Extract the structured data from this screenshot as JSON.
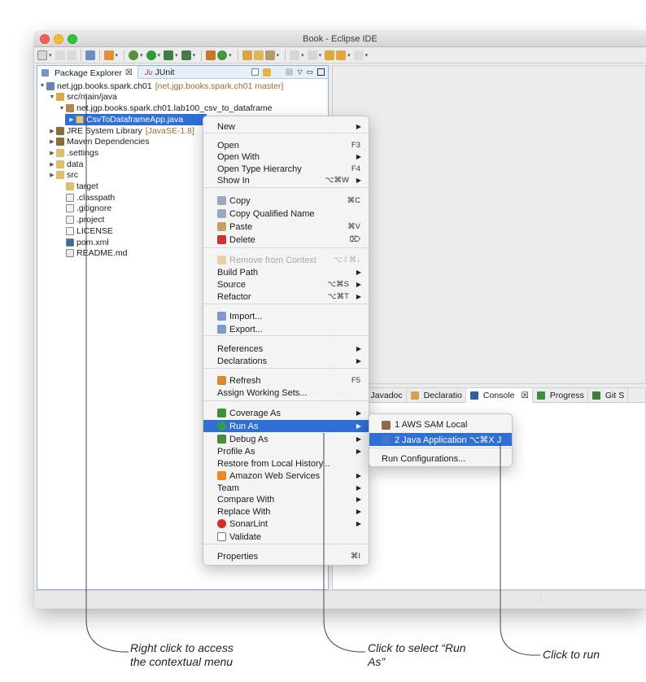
{
  "window": {
    "title": "Book - Eclipse IDE"
  },
  "explorer": {
    "tab_label": "Package Explorer",
    "tab_close": "☒",
    "junit_tab": "JUnit",
    "junit_prefix": "Ju",
    "tree": [
      {
        "label": "net.jgp.books.spark.ch01",
        "deco": "[net.jgp.books.spark.ch01 master]",
        "icon": "project-icon",
        "twisty": "▼"
      },
      {
        "label": "src/main/java",
        "deco": "",
        "icon": "source-folder-icon",
        "twisty": "▼"
      },
      {
        "label": "net.jgp.books.spark.ch01.lab100_csv_to_dataframe",
        "deco": "",
        "icon": "package-icon",
        "twisty": "▼"
      },
      {
        "label": "CsvToDataframeApp.java",
        "deco": "",
        "icon": "java-file-icon",
        "twisty": "▶"
      },
      {
        "label": "JRE System Library",
        "deco": "[JavaSE-1.8]",
        "icon": "library-icon",
        "twisty": "▶"
      },
      {
        "label": "Maven Dependencies",
        "deco": "",
        "icon": "library-icon",
        "twisty": "▶"
      },
      {
        "label": ".settings",
        "deco": "",
        "icon": "folder-icon",
        "twisty": "▶"
      },
      {
        "label": "data",
        "deco": "",
        "icon": "folder-icon",
        "twisty": "▶"
      },
      {
        "label": "src",
        "deco": "",
        "icon": "folder-icon",
        "twisty": "▶"
      },
      {
        "label": "target",
        "deco": "",
        "icon": "folder-icon",
        "twisty": ""
      },
      {
        "label": ".classpath",
        "deco": "",
        "icon": "xml-file-icon",
        "twisty": ""
      },
      {
        "label": ".gitignore",
        "deco": "",
        "icon": "text-file-icon",
        "twisty": ""
      },
      {
        "label": ".project",
        "deco": "",
        "icon": "xml-file-icon",
        "twisty": ""
      },
      {
        "label": "LICENSE",
        "deco": "",
        "icon": "text-file-icon",
        "twisty": ""
      },
      {
        "label": "pom.xml",
        "deco": "",
        "icon": "maven-file-icon",
        "twisty": ""
      },
      {
        "label": "README.md",
        "deco": "",
        "icon": "markdown-file-icon",
        "twisty": ""
      }
    ]
  },
  "console_tabs": [
    {
      "label": "ems",
      "icon": ""
    },
    {
      "label": "Javadoc",
      "icon": "@"
    },
    {
      "label": "Declaratio",
      "icon": "decl"
    },
    {
      "label": "Console",
      "icon": "console",
      "close": "☒"
    },
    {
      "label": "Progress",
      "icon": "progress"
    },
    {
      "label": "Git S",
      "icon": "git"
    }
  ],
  "context_menu": {
    "items": [
      {
        "label": "New",
        "shortcut": "",
        "submenu": true,
        "icon": ""
      },
      {
        "label": "Open",
        "shortcut": "F3",
        "submenu": false,
        "icon": ""
      },
      {
        "label": "Open With",
        "shortcut": "",
        "submenu": true,
        "icon": ""
      },
      {
        "label": "Open Type Hierarchy",
        "shortcut": "F4",
        "submenu": false,
        "icon": ""
      },
      {
        "label": "Show In",
        "shortcut": "⌥⌘W",
        "submenu": true,
        "icon": ""
      },
      {
        "label": "Copy",
        "shortcut": "⌘C",
        "submenu": false,
        "icon": "copy-icon"
      },
      {
        "label": "Copy Qualified Name",
        "shortcut": "",
        "submenu": false,
        "icon": "copy-qualified-icon"
      },
      {
        "label": "Paste",
        "shortcut": "⌘V",
        "submenu": false,
        "icon": "paste-icon"
      },
      {
        "label": "Delete",
        "shortcut": "⌦",
        "submenu": false,
        "icon": "delete-icon"
      },
      {
        "label": "Remove from Context",
        "shortcut": "⌥⇧⌘↓",
        "submenu": false,
        "icon": "remove-context-icon",
        "disabled": true
      },
      {
        "label": "Build Path",
        "shortcut": "",
        "submenu": true,
        "icon": ""
      },
      {
        "label": "Source",
        "shortcut": "⌥⌘S",
        "submenu": true,
        "icon": ""
      },
      {
        "label": "Refactor",
        "shortcut": "⌥⌘T",
        "submenu": true,
        "icon": ""
      },
      {
        "label": "Import...",
        "shortcut": "",
        "submenu": false,
        "icon": "import-icon"
      },
      {
        "label": "Export...",
        "shortcut": "",
        "submenu": false,
        "icon": "export-icon"
      },
      {
        "label": "References",
        "shortcut": "",
        "submenu": true,
        "icon": ""
      },
      {
        "label": "Declarations",
        "shortcut": "",
        "submenu": true,
        "icon": ""
      },
      {
        "label": "Refresh",
        "shortcut": "F5",
        "submenu": false,
        "icon": "refresh-icon"
      },
      {
        "label": "Assign Working Sets...",
        "shortcut": "",
        "submenu": false,
        "icon": ""
      },
      {
        "label": "Coverage As",
        "shortcut": "",
        "submenu": true,
        "icon": "coverage-icon"
      },
      {
        "label": "Run As",
        "shortcut": "",
        "submenu": true,
        "icon": "run-icon",
        "highlighted": true
      },
      {
        "label": "Debug As",
        "shortcut": "",
        "submenu": true,
        "icon": "debug-icon"
      },
      {
        "label": "Profile As",
        "shortcut": "",
        "submenu": true,
        "icon": ""
      },
      {
        "label": "Restore from Local History...",
        "shortcut": "",
        "submenu": false,
        "icon": ""
      },
      {
        "label": "Amazon Web Services",
        "shortcut": "",
        "submenu": true,
        "icon": "aws-icon"
      },
      {
        "label": "Team",
        "shortcut": "",
        "submenu": true,
        "icon": ""
      },
      {
        "label": "Compare With",
        "shortcut": "",
        "submenu": true,
        "icon": ""
      },
      {
        "label": "Replace With",
        "shortcut": "",
        "submenu": true,
        "icon": ""
      },
      {
        "label": "SonarLint",
        "shortcut": "",
        "submenu": true,
        "icon": "sonarlint-icon"
      },
      {
        "label": "Validate",
        "shortcut": "",
        "submenu": false,
        "icon": "validate-icon"
      },
      {
        "label": "Properties",
        "shortcut": "⌘I",
        "submenu": false,
        "icon": ""
      }
    ]
  },
  "run_as_submenu": {
    "items": [
      {
        "label": "1 AWS SAM Local",
        "icon": "aws-sam-icon"
      },
      {
        "label": "2 Java Application ⌥⌘X J",
        "icon": "java-app-icon",
        "highlighted": true
      },
      {
        "label": "Run Configurations...",
        "icon": ""
      }
    ]
  },
  "callouts": {
    "left": [
      "Right click to access",
      "the contextual menu"
    ],
    "middle": [
      "Click to select “Run",
      "As”"
    ],
    "right": [
      "Click to run"
    ]
  },
  "colors": {
    "selection": "#2f6fd6",
    "deco": "#a06a2b"
  }
}
